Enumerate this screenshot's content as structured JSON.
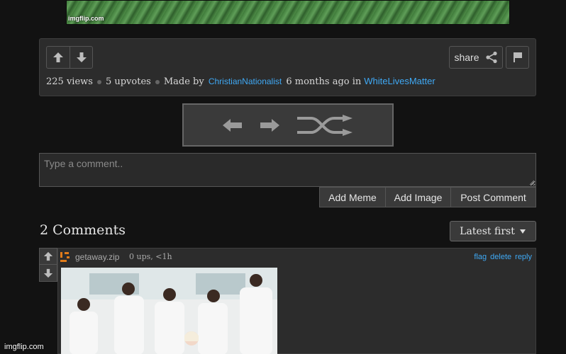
{
  "top_image": {
    "watermark": "imgflip.com"
  },
  "post": {
    "share_label": "share",
    "views": "225 views",
    "upvotes": "5 upvotes",
    "made_by_prefix": "Made by",
    "author": "ChristianNationalist",
    "time_prefix": "6 months ago in",
    "stream": "WhiteLivesMatter"
  },
  "comment_box": {
    "placeholder": "Type a comment..",
    "add_meme": "Add Meme",
    "add_image": "Add Image",
    "post_comment": "Post Comment"
  },
  "comments": {
    "heading": "2 Comments",
    "sort_label": "Latest first",
    "items": [
      {
        "username": "getaway.zip",
        "stats": "0 ups, <1h",
        "links": [
          "flag",
          "delete",
          "reply"
        ]
      }
    ]
  },
  "footer": {
    "watermark": "imgflip.com"
  },
  "colors": {
    "link": "#3fa9f5",
    "panel": "#2c2c2c",
    "background": "#121212",
    "avatar_accent": "#e07b1a"
  }
}
